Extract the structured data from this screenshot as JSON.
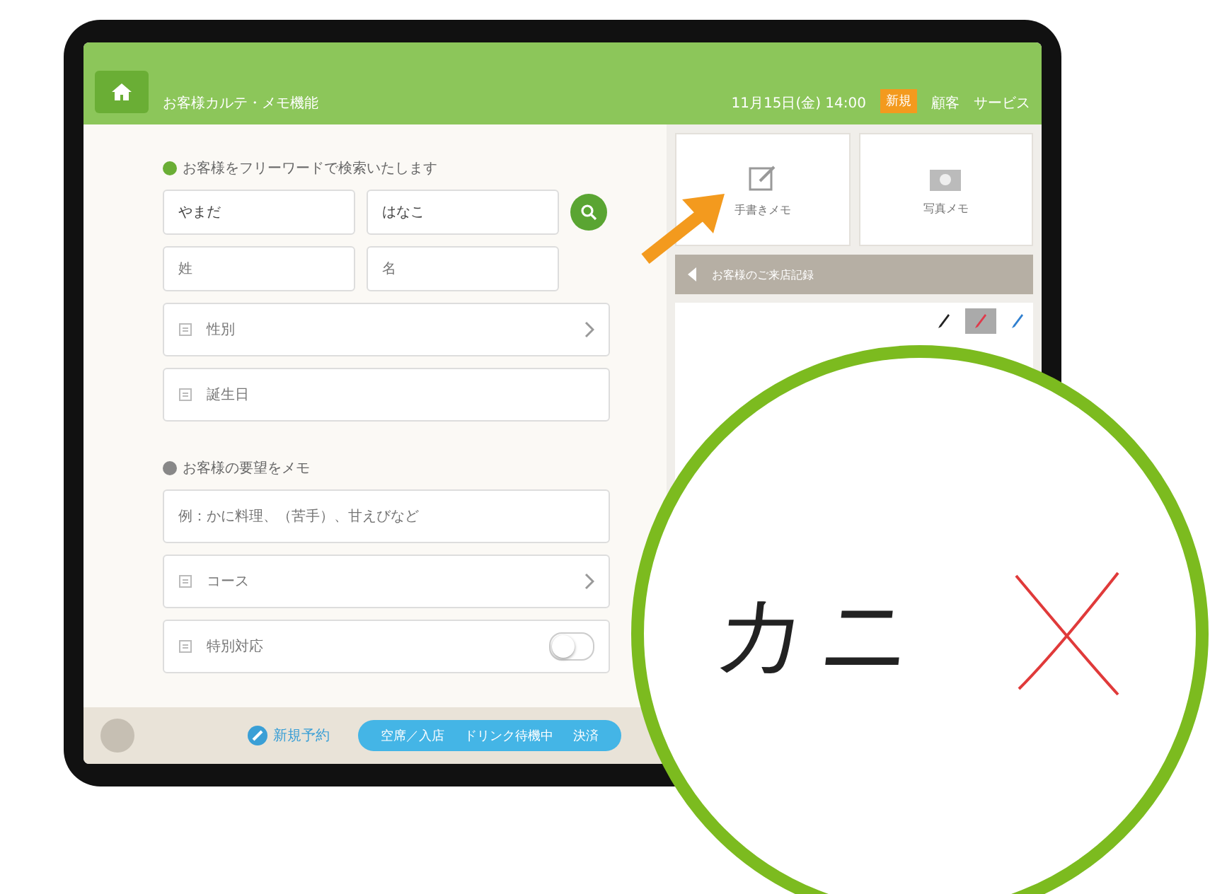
{
  "header": {
    "title": "お客様カルテ・メモ機能",
    "date": "11月15日(金) 14:00",
    "badge": "新規",
    "links": [
      "顧客",
      "サービス"
    ]
  },
  "search": {
    "heading": "お客様をフリーワードで検索いたします",
    "fields": [
      {
        "value": "やまだ"
      },
      {
        "value": "はなこ"
      },
      {
        "placeholder": "姓"
      },
      {
        "placeholder": "名"
      }
    ]
  },
  "rows_1": [
    {
      "kind": "chevron",
      "label": "性別"
    },
    {
      "kind": "plain",
      "label": "誕生日"
    }
  ],
  "notes": {
    "heading": "お客様の要望をメモ",
    "placeholder": "例：かに料理、（苦手）、甘えびなど"
  },
  "rows_2": [
    {
      "kind": "chevron",
      "label": "コース"
    },
    {
      "kind": "toggle",
      "label": "特別対応",
      "on": false
    }
  ],
  "bottom_bar": {
    "new_label": "新規予約",
    "pill": [
      "空席／入店",
      "ドリンク待機中",
      "決済"
    ]
  },
  "tiles": [
    {
      "kind": "pencil",
      "label": "手書きメモ"
    },
    {
      "kind": "camera",
      "label": "写真メモ"
    }
  ],
  "record_bar": {
    "title": "お客様のご来店記録"
  },
  "pens": [
    {
      "color": "#222222",
      "selected": false
    },
    {
      "color": "#e0394a",
      "selected": true
    },
    {
      "color": "#2f7fd0",
      "selected": false
    }
  ],
  "zoom": {
    "handwriting": "カニ"
  }
}
